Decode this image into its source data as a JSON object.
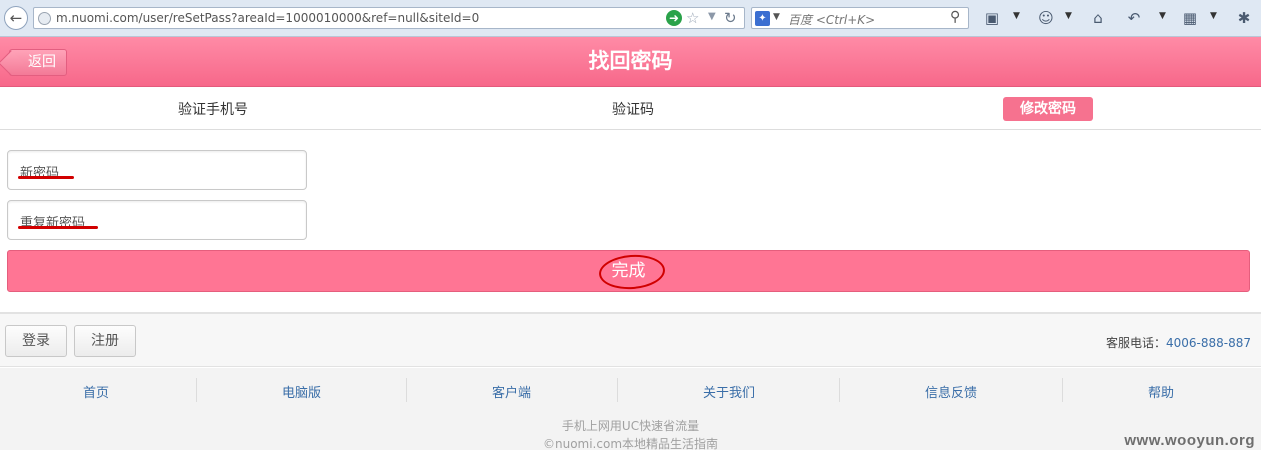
{
  "browser": {
    "url": "m.nuomi.com/user/reSetPass?areaId=1000010000&ref=null&siteId=0",
    "search_placeholder": "百度 <Ctrl+K>",
    "icons": [
      "back-icon",
      "globe-icon",
      "go-icon",
      "star-icon",
      "reload-icon",
      "baidu-icon",
      "magnifier-icon",
      "screenshot-icon",
      "smiley-icon",
      "home-icon",
      "undo-icon",
      "apps-icon",
      "bug-icon"
    ]
  },
  "header": {
    "back_label": "返回",
    "title": "找回密码"
  },
  "steps": {
    "step1": "验证手机号",
    "step2": "验证码",
    "step3": "修改密码"
  },
  "form": {
    "new_password_placeholder": "新密码",
    "repeat_password_placeholder": "重复新密码",
    "submit_label": "完成"
  },
  "footer": {
    "login_label": "登录",
    "register_label": "注册",
    "hotline_label": "客服电话：",
    "hotline_number": "4006-888-887",
    "links": [
      "首页",
      "电脑版",
      "客户端",
      "关于我们",
      "信息反馈",
      "帮助"
    ],
    "line1": "手机上网用UC快速省流量",
    "line2": "©nuomi.com本地精品生活指南"
  },
  "watermark": "www.wooyun.org",
  "colors": {
    "brand_pink": "#ff7594",
    "header_pink": "#f7688a",
    "annotation_red": "#d00000",
    "link_blue": "#3a6ea8"
  }
}
